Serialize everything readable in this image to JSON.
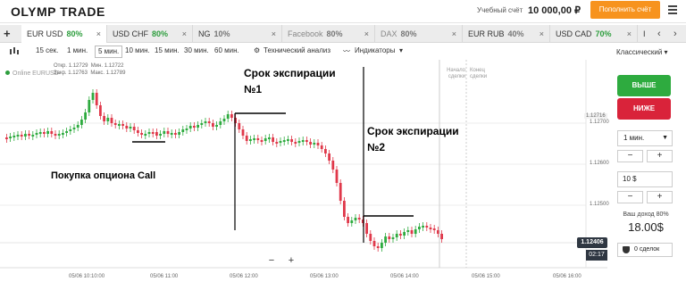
{
  "header": {
    "logo": "OLYMP TRADE",
    "balance_label": "Учебный счёт",
    "balance_value": "10 000,00 ₽",
    "topup_label": "Пополнить счёт"
  },
  "tabs": [
    {
      "label": "EUR USD",
      "pct": "80%",
      "pct_color": "green",
      "active": true
    },
    {
      "label": "USD CHF",
      "pct": "80%",
      "pct_color": "green",
      "active": false
    },
    {
      "label": "NG",
      "pct": "10%",
      "pct_color": "gray",
      "active": false
    },
    {
      "label": "Facebook",
      "pct": "80%",
      "pct_color": "gray",
      "active": false,
      "dim": true
    },
    {
      "label": "DAX",
      "pct": "80%",
      "pct_color": "gray",
      "active": false,
      "dim": true
    },
    {
      "label": "EUR RUB",
      "pct": "40%",
      "pct_color": "gray",
      "active": false
    },
    {
      "label": "USD CAD",
      "pct": "70%",
      "pct_color": "green",
      "active": false
    },
    {
      "label": "I",
      "pct": "",
      "pct_color": "gray",
      "active": false
    }
  ],
  "toolbar": {
    "timeframes": [
      "15 сек.",
      "1 мин.",
      "5 мин.",
      "10 мин.",
      "15 мин.",
      "30 мин.",
      "60 мин."
    ],
    "active_timeframe": "5 мин.",
    "tech_analysis": "Технический анализ",
    "indicators": "Индикаторы",
    "chart_view": "Классический"
  },
  "chart": {
    "online_label": "Online EURUSD",
    "ohlc": {
      "open_label": "Откр.",
      "open": "1.12729",
      "close_label": "Закр.",
      "close": "1.12763",
      "min_label": "Мин.",
      "min": "1.12722",
      "max_label": "Макс.",
      "max": "1.12789"
    },
    "price_labels": [
      "1.12716",
      "1.12700",
      "1.12600",
      "1.12500"
    ],
    "current_price": "1.12406",
    "timer": "02:17",
    "time_labels": [
      "05/06 10:10:00",
      "05/06 11:00",
      "05/06 12:00",
      "05/06 13:00",
      "05/06 14:00",
      "05/06 15:00",
      "05/06 16:00"
    ],
    "deal_start_label_1": "Начало",
    "deal_start_label_2": "сделки",
    "expiry_end_label_1": "Конец",
    "expiry_end_label_2": "сделки",
    "annotations": {
      "exp1_line1": "Срок экспирации",
      "exp1_line2": "№1",
      "exp2_line1": "Срок экспирации",
      "exp2_line2": "№2",
      "call_label": "Покупка опциона Call"
    },
    "zoom_minus": "−",
    "zoom_plus": "+"
  },
  "sidebar": {
    "up_label": "ВЫШЕ",
    "down_label": "НИЖЕ",
    "duration": "1 мин.",
    "minus": "−",
    "plus": "+",
    "amount": "10 $",
    "income_label": "Ваш доход 80%",
    "income_value": "18.00$",
    "deals": "0 сделок"
  },
  "colors": {
    "bull": "#2eab3f",
    "bear": "#e0384a",
    "accent": "#f7931e",
    "up_button": "#2eab3f",
    "down_button": "#d9233a"
  }
}
